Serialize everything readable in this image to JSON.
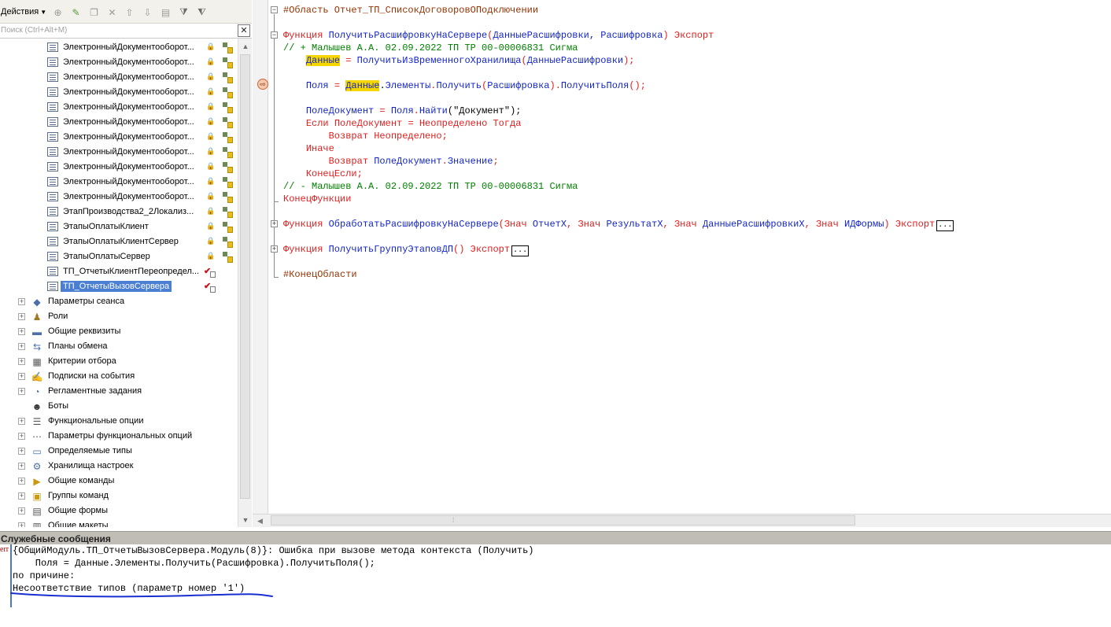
{
  "toolbar": {
    "actions_label": "Действия",
    "icons": [
      "add-icon",
      "edit-icon",
      "copy-icon",
      "delete-icon",
      "move-up-icon",
      "move-down-icon",
      "list-icon",
      "filter-icon",
      "clear-filter-icon"
    ]
  },
  "search": {
    "placeholder": "Поиск (Ctrl+Alt+M)"
  },
  "tree": {
    "modules": [
      {
        "label": "ЭлектронныйДокументооборот..."
      },
      {
        "label": "ЭлектронныйДокументооборот..."
      },
      {
        "label": "ЭлектронныйДокументооборот..."
      },
      {
        "label": "ЭлектронныйДокументооборот..."
      },
      {
        "label": "ЭлектронныйДокументооборот..."
      },
      {
        "label": "ЭлектронныйДокументооборот..."
      },
      {
        "label": "ЭлектронныйДокументооборот..."
      },
      {
        "label": "ЭлектронныйДокументооборот..."
      },
      {
        "label": "ЭлектронныйДокументооборот..."
      },
      {
        "label": "ЭлектронныйДокументооборот..."
      },
      {
        "label": "ЭлектронныйДокументооборот..."
      },
      {
        "label": "ЭтапПроизводства2_2Локализ..."
      },
      {
        "label": "ЭтапыОплатыКлиент"
      },
      {
        "label": "ЭтапыОплатыКлиентСервер"
      },
      {
        "label": "ЭтапыОплатыСервер"
      },
      {
        "label": "ТП_ОтчетыКлиентПереопредел..."
      },
      {
        "label": "ТП_ОтчетыВызовСервера",
        "selected": true
      }
    ],
    "categories": [
      {
        "label": "Параметры сеанса",
        "icon": "session-params-icon"
      },
      {
        "label": "Роли",
        "icon": "roles-icon"
      },
      {
        "label": "Общие реквизиты",
        "icon": "common-attributes-icon"
      },
      {
        "label": "Планы обмена",
        "icon": "exchange-plans-icon"
      },
      {
        "label": "Критерии отбора",
        "icon": "filter-criteria-icon"
      },
      {
        "label": "Подписки на события",
        "icon": "event-subscriptions-icon"
      },
      {
        "label": "Регламентные задания",
        "icon": "scheduled-jobs-icon"
      },
      {
        "label": "Боты",
        "icon": "bots-icon"
      },
      {
        "label": "Функциональные опции",
        "icon": "functional-options-icon"
      },
      {
        "label": "Параметры функциональных опций",
        "icon": "functional-option-params-icon"
      },
      {
        "label": "Определяемые типы",
        "icon": "defined-types-icon"
      },
      {
        "label": "Хранилища настроек",
        "icon": "settings-storage-icon"
      },
      {
        "label": "Общие команды",
        "icon": "common-commands-icon"
      },
      {
        "label": "Группы команд",
        "icon": "command-groups-icon"
      },
      {
        "label": "Общие формы",
        "icon": "common-forms-icon"
      },
      {
        "label": "Общие макеты",
        "icon": "common-templates-icon"
      }
    ]
  },
  "code": {
    "l1": {
      "region": "#Область Отчет_ТП_СписокДоговоровОПодключении"
    },
    "l3": {
      "kw1": "Функция ",
      "name": "ПолучитьРасшифровкуНаСервере",
      "p1": "(",
      "args": "ДанныеРасшифровки, Расшифровка",
      "p2": ")",
      "kw2": " Экспорт"
    },
    "l4": {
      "comment": "// + Малышев А.А. 02.09.2022 ТП ТР 00-00006831 Сигма"
    },
    "l5": {
      "a": "Данные",
      "b": " = ",
      "c": "ПолучитьИзВременногоХранилища",
      "d": "(",
      "e": "ДанныеРасшифровки",
      "f": ");"
    },
    "l7": {
      "a": "Поля",
      "b": " = ",
      "c": "Данные",
      "d": ".",
      "e": "Элементы",
      "f": ".",
      "g": "Получить",
      "h": "(",
      "i": "Расшифровка",
      "j": ").",
      "k": "ПолучитьПоля",
      "l": "();"
    },
    "l9": {
      "a": "ПолеДокумент",
      "b": " = ",
      "c": "Поля",
      "d": ".",
      "e": "Найти",
      "f": "(\"Документ\");"
    },
    "l10": {
      "a": "Если ",
      "b": "ПолеДокумент",
      "c": " = ",
      "d": "Неопределено Тогда"
    },
    "l11": {
      "a": "Возврат ",
      "b": "Неопределено",
      "c": ";"
    },
    "l12": {
      "a": "Иначе"
    },
    "l13": {
      "a": "Возврат ",
      "b": "ПолеДокумент",
      "c": ".",
      "d": "Значение",
      "e": ";"
    },
    "l14": {
      "a": "КонецЕсли;"
    },
    "l15": {
      "comment": "// - Малышев А.А. 02.09.2022 ТП ТР 00-00006831 Сигма"
    },
    "l16": {
      "a": "КонецФункции"
    },
    "l18": {
      "kw1": "Функция ",
      "name": "ОбработатьРасшифровкуНаСервере",
      "p1": "(",
      "v1": "Знач ",
      "a1": "ОтчетХ",
      "c1": ", ",
      "v2": "Знач ",
      "a2": "РезультатХ",
      "c2": ", ",
      "v3": "Знач ",
      "a3": "ДанныеРасшифровкиХ",
      "c3": ", ",
      "v4": "Знач ",
      "a4": "ИДФормы",
      "p2": ")",
      "kw2": " Экспорт",
      "coll": "..."
    },
    "l20": {
      "kw1": "Функция ",
      "name": "ПолучитьГруппуЭтаповДП",
      "p": "()",
      "kw2": " Экспорт",
      "coll": "..."
    },
    "l22": {
      "region_end": "#КонецОбласти"
    }
  },
  "messages": {
    "title": "Служебные сообщения",
    "err_tag": "err",
    "lines": [
      "{ОбщийМодуль.ТП_ОтчетыВызовСервера.Модуль(8)}: Ошибка при вызове метода контекста (Получить)",
      "    Поля = Данные.Элементы.Получить(Расшифровка).ПолучитьПоля();",
      "по причине:",
      "Несоответствие типов (параметр номер '1')"
    ]
  },
  "colors": {
    "keyword": "#e02020",
    "identifier": "#1426c8",
    "comment": "#008000",
    "preprocessor": "#963200",
    "highlight": "#f5d600",
    "selection": "#4a7fd3",
    "annotation": "#1a2fd0"
  }
}
